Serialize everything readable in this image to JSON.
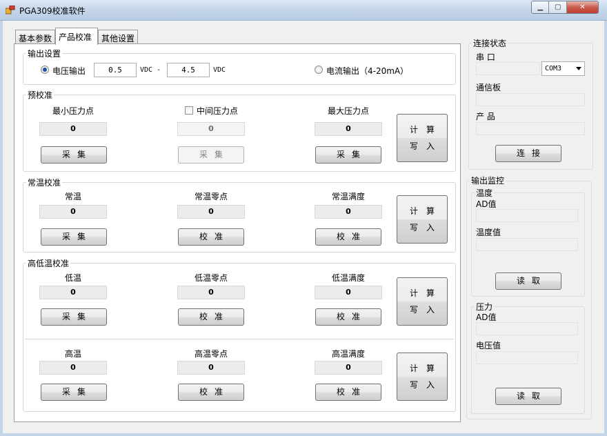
{
  "window": {
    "title": "PGA309校准软件",
    "controls": {
      "minimize": "▁",
      "maximize": "▢",
      "close": "✕"
    }
  },
  "tabs": [
    {
      "label": "基本参数",
      "active": false
    },
    {
      "label": "产品校准",
      "active": true
    },
    {
      "label": "其他设置",
      "active": false
    }
  ],
  "output_settings": {
    "legend": "输出设置",
    "voltage_radio_label": "电压输出",
    "voltage_selected": true,
    "vmin_value": "0.5",
    "vmin_unit": "VDC",
    "dash": "-",
    "vmax_value": "4.5",
    "vmax_unit": "VDC",
    "current_radio_label": "电流输出（4-20mA）"
  },
  "pre_calibration": {
    "legend": "预校准",
    "min_label": "最小压力点",
    "min_value": "0",
    "min_button": "采集",
    "mid_checkbox_label": "中间压力点",
    "mid_checked": false,
    "mid_value": "0",
    "mid_button": "采集",
    "max_label": "最大压力点",
    "max_value": "0",
    "max_button": "采集",
    "calc_line1": "计算",
    "calc_line2": "写入"
  },
  "normal_temp": {
    "legend": "常温校准",
    "col1_label": "常温",
    "col1_value": "0",
    "col1_button": "采集",
    "col2_label": "常温零点",
    "col2_value": "0",
    "col2_button": "校准",
    "col3_label": "常温满度",
    "col3_value": "0",
    "col3_button": "校准",
    "calc_line1": "计算",
    "calc_line2": "写入"
  },
  "low_temp": {
    "legend": "高低温校准",
    "col1_label": "低温",
    "col1_value": "0",
    "col1_button": "采集",
    "col2_label": "低温零点",
    "col2_value": "0",
    "col2_button": "校准",
    "col3_label": "低温满度",
    "col3_value": "0",
    "col3_button": "校准",
    "calc_line1": "计算",
    "calc_line2": "写入"
  },
  "high_temp": {
    "col1_label": "高温",
    "col1_value": "0",
    "col1_button": "采集",
    "col2_label": "高温零点",
    "col2_value": "0",
    "col2_button": "校准",
    "col3_label": "高温满度",
    "col3_value": "0",
    "col3_button": "校准",
    "calc_line1": "计算",
    "calc_line2": "写入"
  },
  "connection": {
    "legend": "连接状态",
    "port_label": "串  口",
    "port_value": "",
    "port_select": "COM3",
    "board_label": "通信板",
    "board_value": "",
    "product_label": "产  品",
    "product_value": "",
    "connect_button": "连接"
  },
  "monitor": {
    "legend": "输出监控",
    "temp_legend": "温度",
    "temp_ad_label": "AD值",
    "temp_ad_value": "",
    "temp_value_label": "温度值",
    "temp_value": "",
    "temp_read_button": "读取",
    "pressure_legend": "压力",
    "pressure_ad_label": "AD值",
    "pressure_ad_value": "",
    "voltage_label": "电压值",
    "voltage_value": "",
    "pressure_read_button": "读取"
  }
}
